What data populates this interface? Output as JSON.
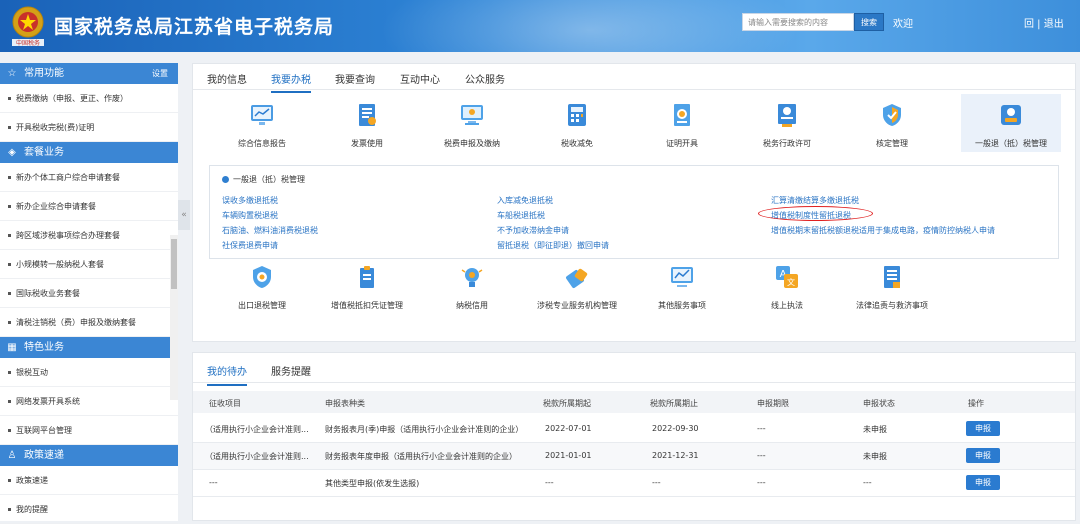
{
  "header": {
    "title": "国家税务总局江苏省电子税务局",
    "search_placeholder": "请输入需要搜索的内容",
    "search_button": "搜索",
    "welcome": "欢迎",
    "links": "回 | 退出"
  },
  "sidebar": {
    "sections": [
      {
        "title": "常用功能",
        "icon": "star-icon",
        "right": "设置",
        "items": [
          "税费缴纳（申报、更正、作废）",
          "开具税收完税(费)证明"
        ]
      },
      {
        "title": "套餐业务",
        "icon": "layers-icon",
        "items": [
          "新办个体工商户综合申请套餐",
          "新办企业综合申请套餐",
          "跨区域涉税事项综合办理套餐",
          "小规模转一般纳税人套餐",
          "国际税收业务套餐",
          "清税注销税（费）申报及缴纳套餐"
        ]
      },
      {
        "title": "特色业务",
        "icon": "grid-icon",
        "items": [
          "银税互动",
          "网络发票开具系统",
          "互联网平台管理"
        ]
      },
      {
        "title": "政策速递",
        "icon": "user-icon",
        "items": [
          "政策速递",
          "我的提醒"
        ]
      }
    ],
    "collapse": "«"
  },
  "tabs": [
    "我的信息",
    "我要办税",
    "我要查询",
    "互动中心",
    "公众服务"
  ],
  "active_tab": "我要办税",
  "top_grid": [
    {
      "label": "综合信息报告",
      "icon": "report-chart-icon"
    },
    {
      "label": "发票使用",
      "icon": "invoice-icon"
    },
    {
      "label": "税费申报及缴纳",
      "icon": "monitor-icon"
    },
    {
      "label": "税收减免",
      "icon": "calculator-icon"
    },
    {
      "label": "证明开具",
      "icon": "certificate-icon"
    },
    {
      "label": "税务行政许可",
      "icon": "license-icon"
    },
    {
      "label": "核定管理",
      "icon": "shield-check-icon"
    },
    {
      "label": "一般退（抵）税管理",
      "icon": "refund-icon"
    }
  ],
  "submenu": {
    "title": "一般退（抵）税管理",
    "links": [
      "误收多缴退抵税",
      "入库减免退抵税",
      "汇算清缴结算多缴退抵税",
      "车辆购置税退税",
      "车船税退抵税",
      "增值税制度性留抵退税",
      "石脑油、燃料油消费税退税",
      "不予加收滞纳金申请",
      "增值税期末留抵税额退税适用于集成电路，疫情防控纳税人申请",
      "社保费退费申请",
      "留抵退税（即征即退）撤回申请"
    ]
  },
  "bottom_grid": [
    {
      "label": "出口退税管理",
      "icon": "export-shield-icon"
    },
    {
      "label": "增值税抵扣凭证管理",
      "icon": "voucher-icon"
    },
    {
      "label": "纳税信用",
      "icon": "credit-bulb-icon"
    },
    {
      "label": "涉税专业服务机构管理",
      "icon": "agency-icon"
    },
    {
      "label": "其他服务事项",
      "icon": "chart-screen-icon"
    },
    {
      "label": "线上执法",
      "icon": "translate-icon"
    },
    {
      "label": "法律追责与救济事项",
      "icon": "document-icon"
    }
  ],
  "todo": {
    "tabs": [
      "我的待办",
      "服务提醒"
    ],
    "headers": [
      "征收项目",
      "申报表种类",
      "税款所属期起",
      "税款所属期止",
      "申报期限",
      "申报状态",
      "操作"
    ],
    "rows": [
      [
        "（适用执行小企业会计准则...",
        "财务报表月(季)申报（适用执行小企业会计准则的企业）",
        "2022-07-01",
        "2022-09-30",
        "---",
        "未申报",
        "申报"
      ],
      [
        "（适用执行小企业会计准则...",
        "财务报表年度申报（适用执行小企业会计准则的企业）",
        "2021-01-01",
        "2021-12-31",
        "---",
        "未申报",
        "申报"
      ],
      [
        "---",
        "其他类型申报(依发生选报)",
        "---",
        "---",
        "---",
        "---",
        "申报"
      ]
    ]
  },
  "colors": {
    "primary": "#2b7bd0",
    "header": "#2f86d8",
    "highlight": "#e02020"
  }
}
